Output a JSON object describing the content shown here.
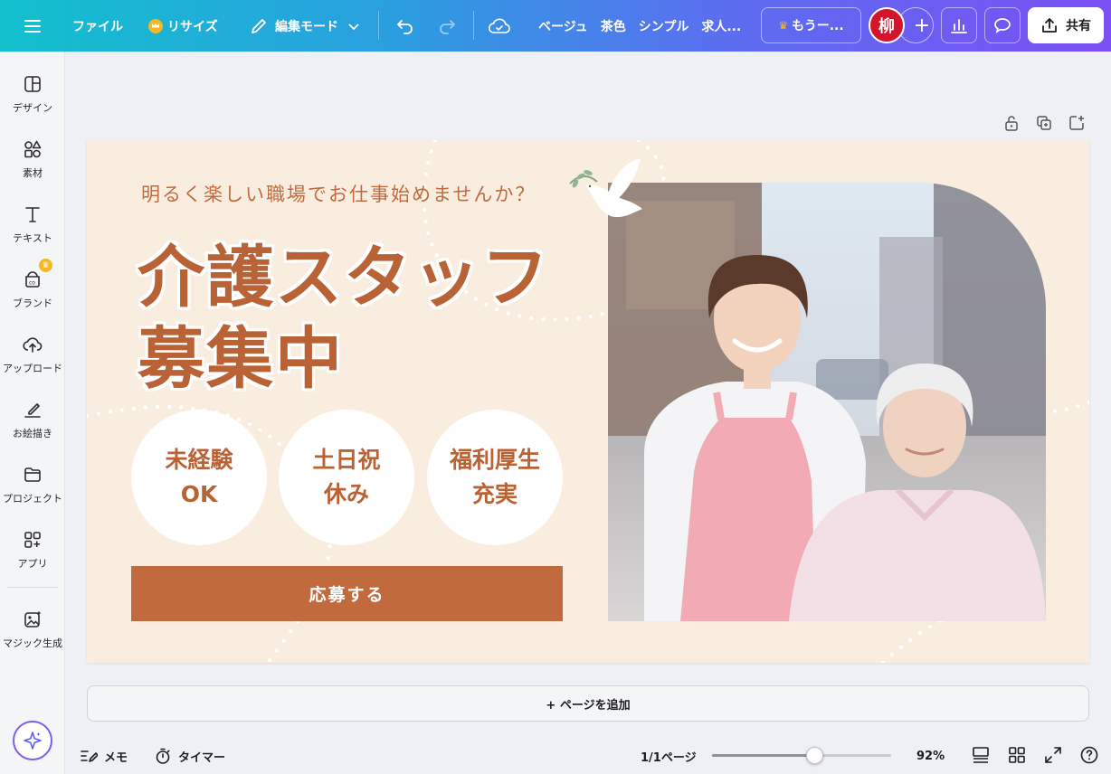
{
  "topbar": {
    "file": "ファイル",
    "resize": "リサイズ",
    "edit_mode": "編集モード",
    "breadcrumb": [
      "ベージュ",
      "茶色",
      "シンプル",
      "求人..."
    ],
    "upgrade": "もうー...",
    "avatar_initial": "柳",
    "share": "共有"
  },
  "sidebar": {
    "items": [
      {
        "label": "デザイン",
        "icon": "design-icon"
      },
      {
        "label": "素材",
        "icon": "elements-icon"
      },
      {
        "label": "テキスト",
        "icon": "text-icon"
      },
      {
        "label": "ブランド",
        "icon": "brand-icon"
      },
      {
        "label": "アップロード",
        "icon": "upload-icon"
      },
      {
        "label": "お絵描き",
        "icon": "draw-icon"
      },
      {
        "label": "プロジェクト",
        "icon": "folder-icon"
      },
      {
        "label": "アプリ",
        "icon": "apps-icon"
      },
      {
        "label": "マジック生成",
        "icon": "magic-media-icon"
      }
    ]
  },
  "design": {
    "tagline": "明るく楽しい職場でお仕事始めませんか？",
    "headline1": "介護スタッフ",
    "headline2": "募集中",
    "circles": [
      {
        "line1": "未経験",
        "line2": "OK"
      },
      {
        "line1": "土日祝",
        "line2": "休み"
      },
      {
        "line1": "福利厚生",
        "line2": "充実"
      }
    ],
    "apply": "応募する",
    "colors": {
      "background": "#f9ede0",
      "accent": "#c06a3e",
      "text_brown": "#b96236"
    }
  },
  "add_page": "+ ページを追加",
  "bottom": {
    "notes": "メモ",
    "timer": "タイマー",
    "page_count": "1/1ページ",
    "zoom": "92%",
    "zoom_fraction": 0.57
  }
}
